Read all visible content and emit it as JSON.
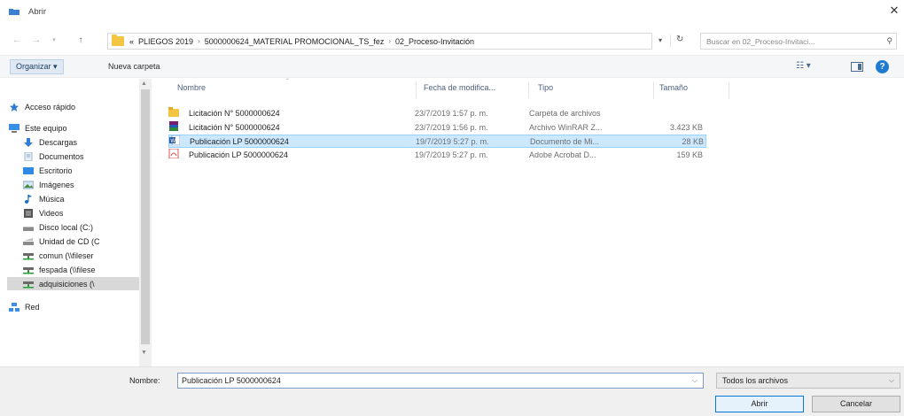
{
  "window": {
    "title": "Abrir",
    "close_glyph": "✕"
  },
  "address": {
    "overflow": "«",
    "crumbs": [
      "PLIEGOS 2019",
      "5000000624_MATERIAL PROMOCIONAL_TS_fez",
      "02_Proceso-Invitación"
    ],
    "search_placeholder": "Buscar en 02_Proceso-Invitaci..."
  },
  "toolbar": {
    "organize_label": "Organizar ▾",
    "new_folder_label": "Nueva carpeta"
  },
  "nav": {
    "items": [
      {
        "label": "Acceso rápido",
        "icon": "star-icon"
      },
      {
        "label": "Este equipo",
        "icon": "computer-icon"
      },
      {
        "label": "Descargas",
        "icon": "download-icon"
      },
      {
        "label": "Documentos",
        "icon": "documents-icon"
      },
      {
        "label": "Escritorio",
        "icon": "desktop-icon"
      },
      {
        "label": "Imágenes",
        "icon": "pictures-icon"
      },
      {
        "label": "Música",
        "icon": "music-icon"
      },
      {
        "label": "Videos",
        "icon": "videos-icon"
      },
      {
        "label": "Disco local (C:)",
        "icon": "drive-icon"
      },
      {
        "label": "Unidad de CD (C",
        "icon": "cd-drive-icon"
      },
      {
        "label": "comun (\\\\fileser",
        "icon": "network-drive-icon"
      },
      {
        "label": "fespada (\\\\filese",
        "icon": "network-drive-icon"
      },
      {
        "label": "adquisiciones (\\",
        "icon": "network-drive-icon"
      },
      {
        "label": "Red",
        "icon": "network-icon"
      }
    ],
    "selected_index": 12
  },
  "list": {
    "headers": {
      "name": "Nombre",
      "date": "Fecha de modifica...",
      "type": "Tipo",
      "size": "Tamaño"
    },
    "rows": [
      {
        "name": "Licitación N° 5000000624",
        "date": "23/7/2019 1:57 p. m.",
        "type": "Carpeta de archivos",
        "size": "",
        "icon": "folder-icon"
      },
      {
        "name": "Licitación N° 5000000624",
        "date": "23/7/2019 1:56 p. m.",
        "type": "Archivo WinRAR Z...",
        "size": "3.423 KB",
        "icon": "winrar-icon"
      },
      {
        "name": "Publicación LP 5000000624",
        "date": "19/7/2019 5:27 p. m.",
        "type": "Documento de Mi...",
        "size": "28 KB",
        "icon": "word-doc-icon"
      },
      {
        "name": "Publicación LP 5000000624",
        "date": "19/7/2019 5:27 p. m.",
        "type": "Adobe Acrobat D...",
        "size": "159 KB",
        "icon": "pdf-icon"
      }
    ],
    "selected_index": 2
  },
  "bottom": {
    "filename_label": "Nombre:",
    "filename_value": "Publicación LP 5000000624",
    "filter_value": "Todos los archivos",
    "open_label": "Abrir",
    "cancel_label": "Cancelar"
  }
}
